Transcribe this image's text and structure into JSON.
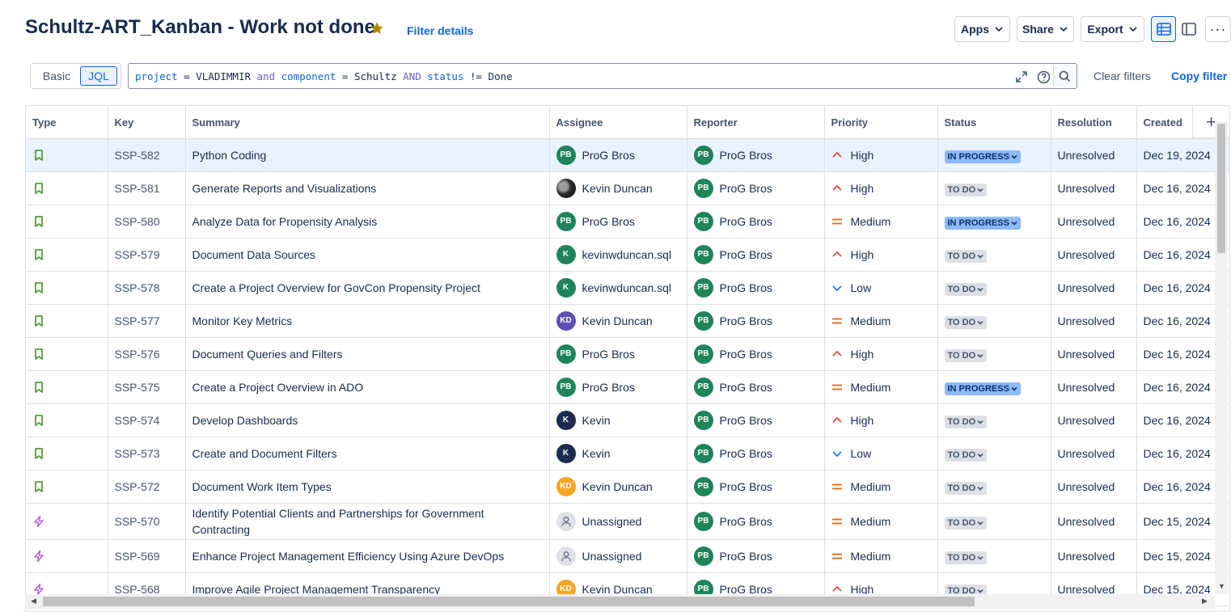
{
  "header": {
    "title": "Schultz-ART_Kanban - Work not done",
    "filter_details": "Filter details",
    "buttons": {
      "apps": "Apps",
      "share": "Share",
      "export": "Export"
    },
    "more": "···"
  },
  "search": {
    "mode_basic": "Basic",
    "mode_jql": "JQL",
    "jql_tokens": [
      {
        "t": "project",
        "k": "field"
      },
      {
        "t": " = ",
        "k": "val"
      },
      {
        "t": "VLADIMMIR",
        "k": "val"
      },
      {
        "t": " and ",
        "k": "op"
      },
      {
        "t": "component",
        "k": "field"
      },
      {
        "t": " = ",
        "k": "val"
      },
      {
        "t": "Schultz",
        "k": "val"
      },
      {
        "t": " AND ",
        "k": "op"
      },
      {
        "t": "status",
        "k": "field"
      },
      {
        "t": " != ",
        "k": "val"
      },
      {
        "t": "Done",
        "k": "val"
      }
    ],
    "clear_filters": "Clear filters",
    "copy_filter": "Copy filter"
  },
  "table": {
    "columns": [
      "Type",
      "Key",
      "Summary",
      "Assignee",
      "Reporter",
      "Priority",
      "Status",
      "Resolution",
      "Created"
    ],
    "rows": [
      {
        "type": "story",
        "key": "SSP-582",
        "summary": "Python Coding",
        "assignee": "ProG Bros",
        "assignee_avatar": "PB",
        "assignee_style": "pb",
        "reporter": "ProG Bros",
        "priority": "High",
        "status": "IN PROGRESS",
        "resolution": "Unresolved",
        "created": "Dec 19, 2024",
        "selected": true
      },
      {
        "type": "story",
        "key": "SSP-581",
        "summary": "Generate Reports and Visualizations",
        "assignee": "Kevin Duncan",
        "assignee_avatar": "",
        "assignee_style": "photo",
        "reporter": "ProG Bros",
        "priority": "High",
        "status": "TO DO",
        "resolution": "Unresolved",
        "created": "Dec 16, 2024"
      },
      {
        "type": "story",
        "key": "SSP-580",
        "summary": "Analyze Data for Propensity Analysis",
        "assignee": "ProG Bros",
        "assignee_avatar": "PB",
        "assignee_style": "pb",
        "reporter": "ProG Bros",
        "priority": "Medium",
        "status": "IN PROGRESS",
        "resolution": "Unresolved",
        "created": "Dec 16, 2024"
      },
      {
        "type": "story",
        "key": "SSP-579",
        "summary": "Document Data Sources",
        "assignee": "kevinwduncan.sql",
        "assignee_avatar": "K",
        "assignee_style": "k",
        "reporter": "ProG Bros",
        "priority": "High",
        "status": "TO DO",
        "resolution": "Unresolved",
        "created": "Dec 16, 2024"
      },
      {
        "type": "story",
        "key": "SSP-578",
        "summary": "Create a Project Overview for GovCon Propensity Project",
        "assignee": "kevinwduncan.sql",
        "assignee_avatar": "K",
        "assignee_style": "k",
        "reporter": "ProG Bros",
        "priority": "Low",
        "status": "TO DO",
        "resolution": "Unresolved",
        "created": "Dec 16, 2024"
      },
      {
        "type": "story",
        "key": "SSP-577",
        "summary": "Monitor Key Metrics",
        "assignee": "Kevin Duncan",
        "assignee_avatar": "KD",
        "assignee_style": "kd-purple",
        "reporter": "ProG Bros",
        "priority": "Medium",
        "status": "TO DO",
        "resolution": "Unresolved",
        "created": "Dec 16, 2024"
      },
      {
        "type": "story",
        "key": "SSP-576",
        "summary": "Document Queries and Filters",
        "assignee": "ProG Bros",
        "assignee_avatar": "PB",
        "assignee_style": "pb",
        "reporter": "ProG Bros",
        "priority": "High",
        "status": "TO DO",
        "resolution": "Unresolved",
        "created": "Dec 16, 2024"
      },
      {
        "type": "story",
        "key": "SSP-575",
        "summary": "Create a Project Overview in ADO",
        "assignee": "ProG Bros",
        "assignee_avatar": "PB",
        "assignee_style": "pb",
        "reporter": "ProG Bros",
        "priority": "Medium",
        "status": "IN PROGRESS",
        "resolution": "Unresolved",
        "created": "Dec 16, 2024"
      },
      {
        "type": "story",
        "key": "SSP-574",
        "summary": "Develop Dashboards",
        "assignee": "Kevin",
        "assignee_avatar": "K",
        "assignee_style": "k-navy",
        "reporter": "ProG Bros",
        "priority": "High",
        "status": "TO DO",
        "resolution": "Unresolved",
        "created": "Dec 16, 2024"
      },
      {
        "type": "story",
        "key": "SSP-573",
        "summary": "Create and Document Filters",
        "assignee": "Kevin",
        "assignee_avatar": "K",
        "assignee_style": "k-navy",
        "reporter": "ProG Bros",
        "priority": "Low",
        "status": "TO DO",
        "resolution": "Unresolved",
        "created": "Dec 16, 2024"
      },
      {
        "type": "story",
        "key": "SSP-572",
        "summary": "Document Work Item Types",
        "assignee": "Kevin Duncan",
        "assignee_avatar": "KD",
        "assignee_style": "kd-orange",
        "reporter": "ProG Bros",
        "priority": "Medium",
        "status": "TO DO",
        "resolution": "Unresolved",
        "created": "Dec 16, 2024"
      },
      {
        "type": "epic",
        "key": "SSP-570",
        "summary": "Identify Potential Clients and Partnerships for Government Contracting",
        "assignee": "Unassigned",
        "assignee_avatar": "",
        "assignee_style": "none",
        "reporter": "ProG Bros",
        "priority": "Medium",
        "status": "TO DO",
        "resolution": "Unresolved",
        "created": "Dec 15, 2024",
        "tall": true
      },
      {
        "type": "epic",
        "key": "SSP-569",
        "summary": "Enhance Project Management Efficiency Using Azure DevOps",
        "assignee": "Unassigned",
        "assignee_avatar": "",
        "assignee_style": "none",
        "reporter": "ProG Bros",
        "priority": "Medium",
        "status": "TO DO",
        "resolution": "Unresolved",
        "created": "Dec 15, 2024"
      },
      {
        "type": "epic",
        "key": "SSP-568",
        "summary": "Improve Agile Project Management Transparency",
        "assignee": "Kevin Duncan",
        "assignee_avatar": "KD",
        "assignee_style": "kd-orange",
        "reporter": "ProG Bros",
        "priority": "High",
        "status": "TO DO",
        "resolution": "Unresolved",
        "created": "Dec 15, 2024"
      }
    ],
    "reporter_avatar": "PB",
    "add_column": "+"
  },
  "colors": {
    "story": "#5b9a3c",
    "epic": "#b460e0",
    "high": "#e2483d",
    "medium": "#e56910",
    "low": "#1d7afc",
    "star": "#b38600"
  }
}
